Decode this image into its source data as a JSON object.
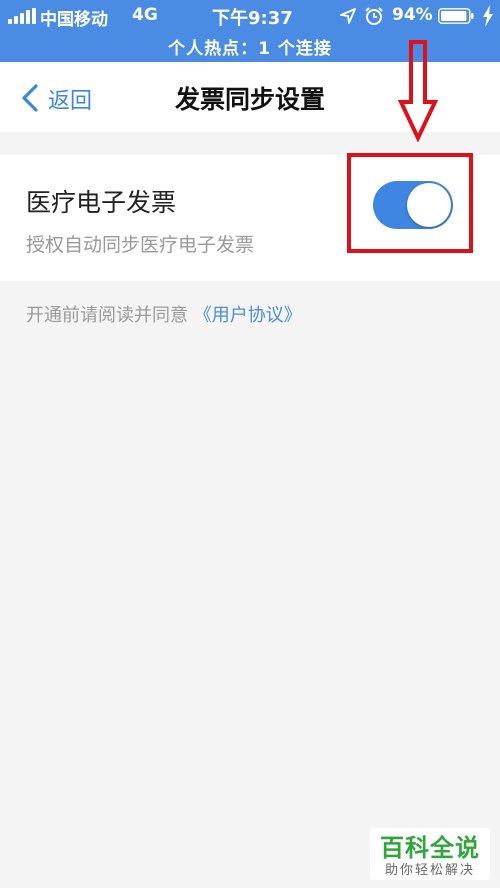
{
  "status_bar": {
    "carrier": "中国移动",
    "network": "4G",
    "time": "下午9:37",
    "battery": "94%",
    "battery_level": 0.94,
    "hotspot": "个人热点：1 个连接",
    "icons": [
      "signal-icon",
      "location-icon",
      "alarm-icon",
      "battery-icon",
      "charging-icon"
    ]
  },
  "nav": {
    "back_label": "返回",
    "title": "发票同步设置"
  },
  "setting": {
    "title": "医疗电子发票",
    "subtitle": "授权自动同步医疗电子发票",
    "enabled": true,
    "toggle_color": "#3f86e2"
  },
  "agreement": {
    "prefix": "开通前请阅读并同意",
    "link": "《用户协议》"
  },
  "annotation": {
    "color": "#e0101a"
  },
  "watermark": {
    "main": "百科全说",
    "sub": "助你轻松解决"
  },
  "colors": {
    "status_bar_bg": "#4a8ce4",
    "accent": "#3b86e0",
    "background": "#f4f4f5"
  }
}
